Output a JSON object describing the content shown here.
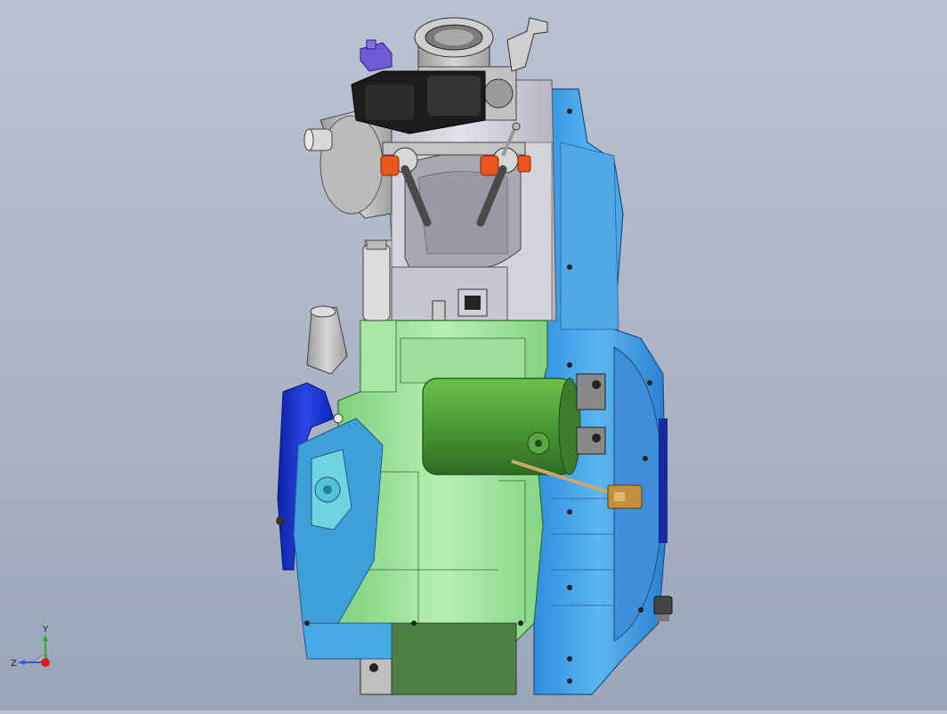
{
  "triad": {
    "x_label": "",
    "y_label": "Y",
    "z_label": "Z"
  },
  "colors": {
    "background_top": "#b9c2d1",
    "background_bottom": "#9aa5b8",
    "crankcase_green": "#9de09a",
    "cover_blue": "#4aa3e0",
    "starter_green": "#4f9a3a",
    "head_grey": "#c9c9d1",
    "throttle_body_grey": "#b7b7b7",
    "actuator_black": "#1c1c1c",
    "coil_orange": "#e8581c",
    "connector_purple": "#6f5bd6",
    "deep_blue_cover": "#1530c8"
  },
  "icons": [
    "coordinate-triad-icon"
  ]
}
